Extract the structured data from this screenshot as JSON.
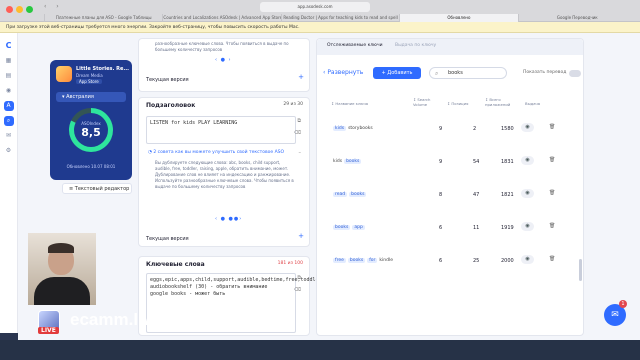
{
  "browser": {
    "url": "app.asodesk.com",
    "tabs": [
      "Платежные планы для ASO - Google Таблицы",
      "Countries and Localizations ASOdesk | Advanced App Store Optimi...",
      "Reading Doctor | Apps for teaching kids to read and spell",
      "Обновлено",
      "Google Переводчик"
    ],
    "active_tab": 3,
    "notice": "При загрузке этой веб-страницы требуется много энергии. Закройте веб-страницу, чтобы повысить скорость работы Mac."
  },
  "app_card": {
    "name": "Little Stories. Re...",
    "developer": "Dream Media",
    "store": "App Store",
    "country": "Австралия",
    "aso_label": "ASOIndex",
    "aso_value": "8,5",
    "aso_progress": 0.82,
    "updated": "Обновлено 10.07 08:01",
    "editor_link": "Текстовый редактор"
  },
  "desc_panel": {
    "text": "разнообразные ключевые слова. Чтобы появиться в выдаче по большему количеству запросов",
    "version_label": "Текущая версия"
  },
  "subtitle_panel": {
    "title": "Подзаголовок",
    "count": "29 из 30",
    "value": "LISTEN for kids PLAY LEARNING",
    "hint": "2 совета как вы можете улучшить свой текстовое ASO",
    "advice": "Вы дублируете следующие слова: abc, books, child support, audible, free, toddler, raising, apple, обратить внимание, может. Дублирование слов не влияет на индексацию и ранжирование. Используйте разнообразные ключевые слова. Чтобы появиться в выдаче по большему количеству запросов",
    "version_label": "Текущая версия"
  },
  "keywords_panel": {
    "title": "Ключевые слова",
    "count": "181 из 100",
    "value": "eggs,epic,apps,child,support,audible,bedtime,free,toddler,children,raising,APP,LITTLE,doctor,apple,",
    "notes": [
      "audiobookshelf (30) - обратить внимание",
      "google books - может быть"
    ]
  },
  "tracked": {
    "tab_tracked": "Отслеживаемые ключи",
    "tab_disabled": "Выдача по ключу",
    "expand": "Развернуть",
    "add": "Добавить",
    "search_value": "books",
    "show_translate": "Показать перевод",
    "headers": [
      "Название ключа",
      "Search Volume",
      "Позиция",
      "Всего приложений",
      "Выдача"
    ],
    "rows": [
      {
        "words": [
          {
            "t": "kids",
            "c": true
          },
          {
            "t": "storybooks",
            "c": false
          }
        ],
        "volume": "9",
        "position": "2",
        "total": "1580"
      },
      {
        "words": [
          {
            "t": "kids",
            "c": false
          },
          {
            "t": "books",
            "c": true
          }
        ],
        "volume": "9",
        "position": "54",
        "total": "1831"
      },
      {
        "words": [
          {
            "t": "read",
            "c": true
          },
          {
            "t": "books",
            "c": true
          }
        ],
        "volume": "8",
        "position": "47",
        "total": "1821"
      },
      {
        "words": [
          {
            "t": "books",
            "c": true
          },
          {
            "t": "app",
            "c": true
          }
        ],
        "volume": "6",
        "position": "11",
        "total": "1919"
      },
      {
        "words": [
          {
            "t": "free",
            "c": true
          },
          {
            "t": "books",
            "c": true
          },
          {
            "t": "for",
            "c": true
          },
          {
            "t": "kindle",
            "c": false
          }
        ],
        "volume": "6",
        "position": "25",
        "total": "2000"
      }
    ]
  },
  "chat": {
    "badge": "1"
  },
  "overlay": {
    "live": "LIVE",
    "watermark": "ecamm.live"
  },
  "colors": {
    "accent": "#2f6bff",
    "app_card": "#1f3a8f",
    "aso_ring": "#2ee59d"
  }
}
